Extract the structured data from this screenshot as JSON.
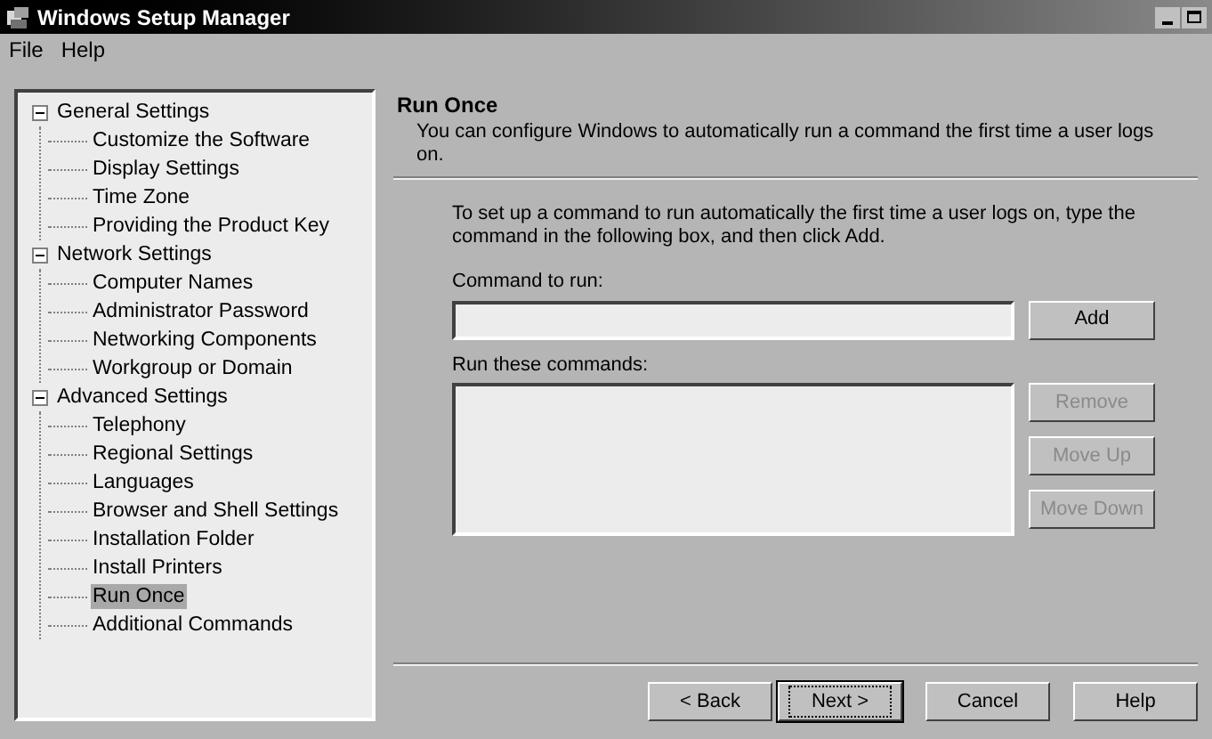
{
  "window": {
    "title": "Windows Setup Manager"
  },
  "menu": [
    "File",
    "Help"
  ],
  "tree": [
    {
      "label": "General Settings",
      "expanded": true,
      "selected": false,
      "children": [
        {
          "label": "Customize the Software",
          "selected": false
        },
        {
          "label": "Display Settings",
          "selected": false
        },
        {
          "label": "Time Zone",
          "selected": false
        },
        {
          "label": "Providing the Product Key",
          "selected": false
        }
      ]
    },
    {
      "label": "Network Settings",
      "expanded": true,
      "selected": false,
      "children": [
        {
          "label": "Computer Names",
          "selected": false
        },
        {
          "label": "Administrator Password",
          "selected": false
        },
        {
          "label": "Networking Components",
          "selected": false
        },
        {
          "label": "Workgroup or Domain",
          "selected": false
        }
      ]
    },
    {
      "label": "Advanced Settings",
      "expanded": true,
      "selected": false,
      "children": [
        {
          "label": "Telephony",
          "selected": false
        },
        {
          "label": "Regional Settings",
          "selected": false
        },
        {
          "label": "Languages",
          "selected": false
        },
        {
          "label": "Browser and Shell Settings",
          "selected": false
        },
        {
          "label": "Installation Folder",
          "selected": false
        },
        {
          "label": "Install Printers",
          "selected": false
        },
        {
          "label": "Run Once",
          "selected": true
        },
        {
          "label": "Additional Commands",
          "selected": false
        }
      ]
    }
  ],
  "page": {
    "title": "Run Once",
    "subtitle": "You can configure Windows to automatically run a command the first time a user logs on.",
    "instructions": "To set up a command to run automatically the first time a user logs on, type the command in the following box, and then click Add.",
    "command_label": "Command to run:",
    "add_button": {
      "label": "Add",
      "disabled": false
    },
    "list_label": "Run these commands:",
    "list_buttons": [
      {
        "label": "Remove",
        "disabled": true
      },
      {
        "label": "Move Up",
        "disabled": true
      },
      {
        "label": "Move Down",
        "disabled": true
      }
    ]
  },
  "nav_buttons": [
    {
      "label": "< Back",
      "default": false
    },
    {
      "label": "Next >",
      "default": true
    },
    {
      "label": "Cancel",
      "default": false
    },
    {
      "label": "Help",
      "default": false
    }
  ]
}
